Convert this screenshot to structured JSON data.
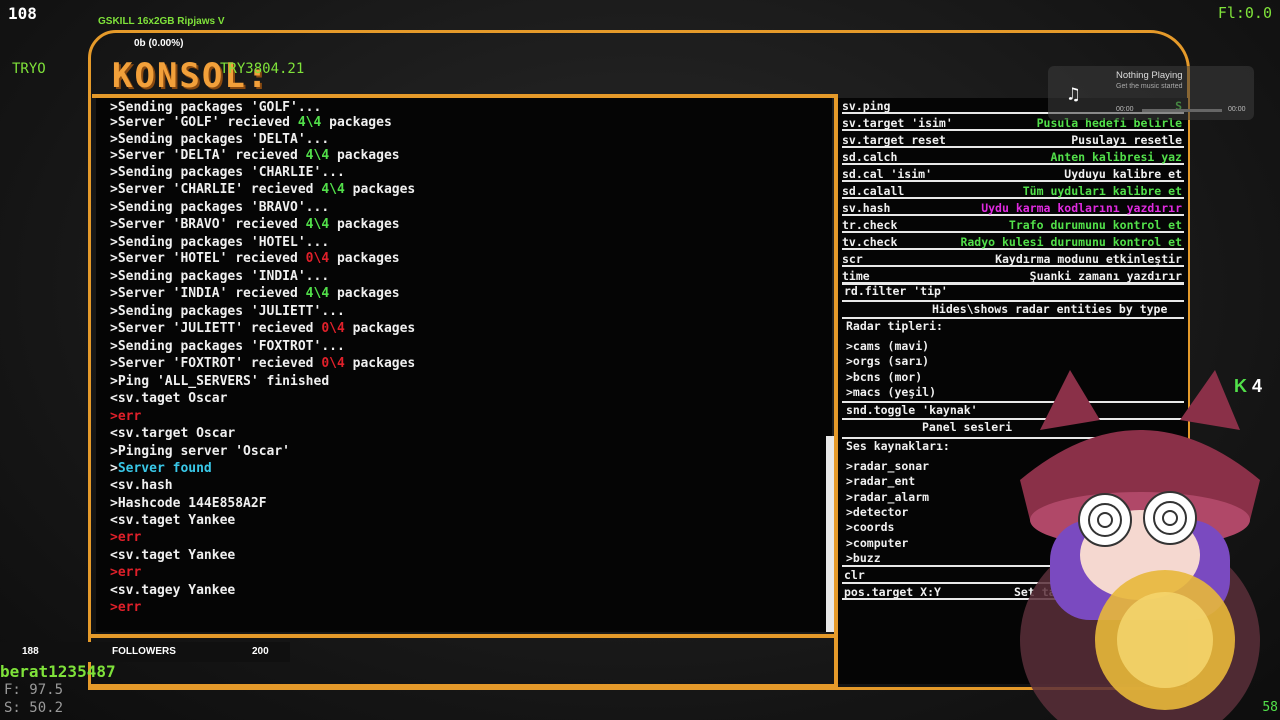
{
  "hud": {
    "fps": "108",
    "ram": "GSKILL 16x2GB Ripjaws V",
    "ram_usage": "0b (0.00%)",
    "fl": "Fl:0.0",
    "tryo": "TRYO",
    "tryv": "TRY3804.21",
    "k_count": "4",
    "corner": "58"
  },
  "console": {
    "title": "KONSOL:",
    "lines": [
      {
        "parts": [
          {
            "t": ">Sending packages 'GOLF'...",
            "c": ""
          }
        ]
      },
      {
        "parts": [
          {
            "t": ">Server 'GOLF' recieved ",
            "c": ""
          },
          {
            "t": "4\\4",
            "c": "g"
          },
          {
            "t": " packages",
            "c": ""
          }
        ]
      },
      {
        "parts": [
          {
            "t": ">Sending packages 'DELTA'...",
            "c": ""
          }
        ]
      },
      {
        "parts": [
          {
            "t": ">Server 'DELTA' recieved ",
            "c": ""
          },
          {
            "t": "4\\4",
            "c": "g"
          },
          {
            "t": " packages",
            "c": ""
          }
        ]
      },
      {
        "parts": [
          {
            "t": ">Sending packages 'CHARLIE'...",
            "c": ""
          }
        ]
      },
      {
        "parts": [
          {
            "t": ">Server 'CHARLIE' recieved ",
            "c": ""
          },
          {
            "t": "4\\4",
            "c": "g"
          },
          {
            "t": " packages",
            "c": ""
          }
        ]
      },
      {
        "parts": [
          {
            "t": ">Sending packages 'BRAVO'...",
            "c": ""
          }
        ]
      },
      {
        "parts": [
          {
            "t": ">Server 'BRAVO' recieved ",
            "c": ""
          },
          {
            "t": "4\\4",
            "c": "g"
          },
          {
            "t": " packages",
            "c": ""
          }
        ]
      },
      {
        "parts": [
          {
            "t": ">Sending packages 'HOTEL'...",
            "c": ""
          }
        ]
      },
      {
        "parts": [
          {
            "t": ">Server 'HOTEL' recieved ",
            "c": ""
          },
          {
            "t": "0\\4",
            "c": "r"
          },
          {
            "t": " packages",
            "c": ""
          }
        ]
      },
      {
        "parts": [
          {
            "t": ">Sending packages 'INDIA'...",
            "c": ""
          }
        ]
      },
      {
        "parts": [
          {
            "t": ">Server 'INDIA' recieved ",
            "c": ""
          },
          {
            "t": "4\\4",
            "c": "g"
          },
          {
            "t": " packages",
            "c": ""
          }
        ]
      },
      {
        "parts": [
          {
            "t": ">Sending packages 'JULIETT'...",
            "c": ""
          }
        ]
      },
      {
        "parts": [
          {
            "t": ">Server 'JULIETT' recieved ",
            "c": ""
          },
          {
            "t": "0\\4",
            "c": "r"
          },
          {
            "t": " packages",
            "c": ""
          }
        ]
      },
      {
        "parts": [
          {
            "t": ">Sending packages 'FOXTROT'...",
            "c": ""
          }
        ]
      },
      {
        "parts": [
          {
            "t": ">Server 'FOXTROT' recieved ",
            "c": ""
          },
          {
            "t": "0\\4",
            "c": "r"
          },
          {
            "t": " packages",
            "c": ""
          }
        ]
      },
      {
        "parts": [
          {
            "t": ">Ping 'ALL_SERVERS' finished",
            "c": ""
          }
        ]
      },
      {
        "parts": [
          {
            "t": "<sv.taget Oscar",
            "c": ""
          }
        ]
      },
      {
        "parts": [
          {
            "t": ">err",
            "c": "r"
          }
        ]
      },
      {
        "parts": [
          {
            "t": "<sv.target Oscar",
            "c": ""
          }
        ]
      },
      {
        "parts": [
          {
            "t": ">Pinging server 'Oscar'",
            "c": ""
          }
        ]
      },
      {
        "parts": [
          {
            "t": ">",
            "c": ""
          },
          {
            "t": "Server found",
            "c": "c"
          }
        ]
      },
      {
        "parts": [
          {
            "t": "<sv.hash",
            "c": ""
          }
        ]
      },
      {
        "parts": [
          {
            "t": ">Hashcode 144E858A2F",
            "c": ""
          }
        ]
      },
      {
        "parts": [
          {
            "t": "<sv.taget Yankee",
            "c": ""
          }
        ]
      },
      {
        "parts": [
          {
            "t": ">err",
            "c": "r"
          }
        ]
      },
      {
        "parts": [
          {
            "t": "<sv.taget Yankee",
            "c": ""
          }
        ]
      },
      {
        "parts": [
          {
            "t": ">err",
            "c": "r"
          }
        ]
      },
      {
        "parts": [
          {
            "t": "<sv.tagey Yankee",
            "c": ""
          }
        ]
      },
      {
        "parts": [
          {
            "t": ">err",
            "c": "r"
          }
        ]
      }
    ]
  },
  "panel": {
    "rows": [
      {
        "cmd": "sv.ping",
        "desc": "S",
        "color": "#52e04a"
      },
      {
        "cmd": "sv.target 'isim'",
        "desc": "Pusula hedefi belirle",
        "color": "#52e04a"
      },
      {
        "cmd": "sv.target reset",
        "desc": "Pusulayı resetle",
        "color": "#f0f0f0"
      },
      {
        "cmd": "sd.calch",
        "desc": "Anten kalibresi yaz",
        "color": "#52e04a"
      },
      {
        "cmd": "sd.cal 'isim'",
        "desc": "Uyduyu kalibre et",
        "color": "#f0f0f0"
      },
      {
        "cmd": "sd.calall",
        "desc": "Tüm uyduları kalibre et",
        "color": "#52e04a"
      },
      {
        "cmd": "sv.hash",
        "desc": "Uydu karma kodlarını yazdırır",
        "color": "#e02ae0"
      },
      {
        "cmd": "tr.check",
        "desc": "Trafo durumunu kontrol et",
        "color": "#52e04a"
      },
      {
        "cmd": "tv.check",
        "desc": "Radyo kulesi durumunu kontrol et",
        "color": "#52e04a"
      },
      {
        "cmd": "scr",
        "desc": "Kaydırma modunu etkinleştir",
        "color": "#f0f0f0"
      },
      {
        "cmd": "time",
        "desc": "Şuanki zamanı yazdırır",
        "color": "#f0f0f0"
      }
    ],
    "rd_filter": "rd.filter 'tip'",
    "rd_filter_desc": "Hides\\shows radar entities by type",
    "radar_title": "Radar tipleri:",
    "radar_types": [
      ">cams (mavi)",
      ">orgs (sarı)",
      ">bcns (mor)",
      ">macs (yeşil)"
    ],
    "snd_toggle": "snd.toggle 'kaynak'",
    "snd_desc": "Panel sesleri",
    "ses_title": "Ses kaynakları:",
    "ses_items": [
      ">radar_sonar",
      ">radar_ent",
      ">radar_alarm",
      ">detector",
      ">coords",
      ">computer",
      ">buzz"
    ],
    "clr": "clr",
    "pos_target": "pos.target X:Y",
    "pos_desc": "Set tar"
  },
  "music": {
    "title": "Nothing Playing",
    "subtitle": "Get the music started",
    "time_start": "00:00",
    "time_end": "00:00",
    "icon": "music-note-icon"
  },
  "followers": {
    "current": "188",
    "label": "FOLLOWERS",
    "goal": "200"
  },
  "user": {
    "name": "berat1235487",
    "f_value": "F: 97.5",
    "s_value": "S: 50.2"
  }
}
